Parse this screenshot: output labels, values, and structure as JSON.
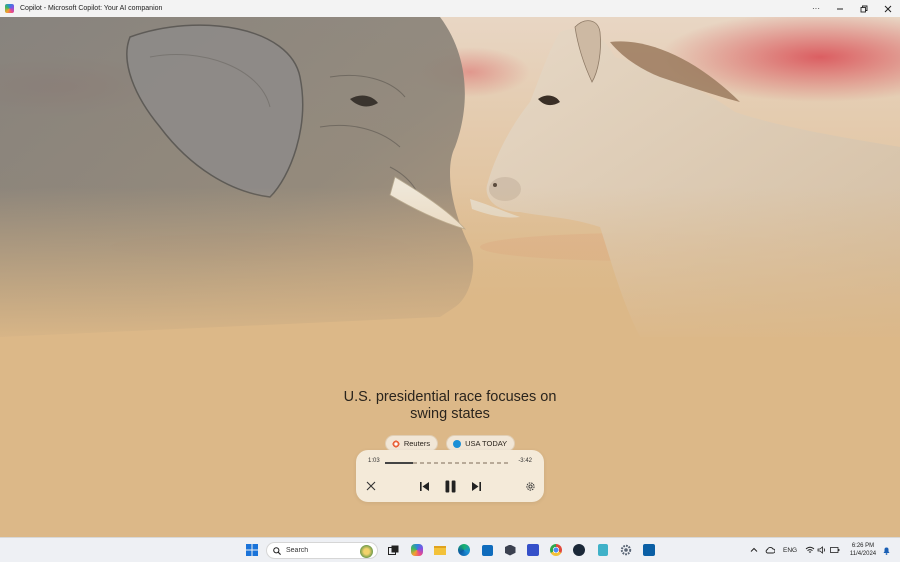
{
  "window": {
    "title": "Copilot - Microsoft Copilot: Your AI companion",
    "controls": [
      "more-icon",
      "minimize-icon",
      "restore-icon",
      "close-icon"
    ]
  },
  "story": {
    "headline_line1": "U.S. presidential race focuses on",
    "headline_line2": "swing states",
    "sources": [
      {
        "name": "Reuters",
        "color": "#e8643b"
      },
      {
        "name": "USA TODAY",
        "color": "#1a8fd6"
      }
    ]
  },
  "player": {
    "elapsed": "1:03",
    "remaining": "-3:42",
    "progress": 0.22,
    "buttons": [
      "close-icon",
      "skip-back-icon",
      "pause-icon",
      "skip-forward-icon",
      "settings-icon"
    ]
  },
  "taskbar": {
    "search_placeholder": "Search",
    "apps": [
      "start-icon",
      "task-view-icon",
      "copilot-icon",
      "file-explorer-icon",
      "edge-icon",
      "store-icon",
      "app-icon",
      "visual-studio-icon",
      "chrome-icon",
      "steam-icon",
      "notepad-icon",
      "settings-icon",
      "media-app-icon"
    ],
    "tray": {
      "language": "ENG",
      "time": "6:26 PM",
      "date": "11/4/2024"
    }
  }
}
